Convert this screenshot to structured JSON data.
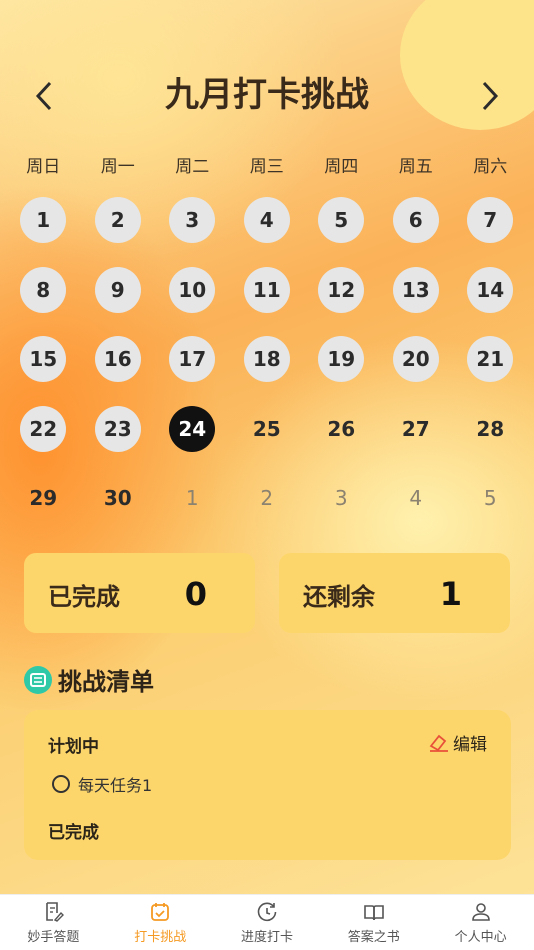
{
  "header": {
    "title": "九月打卡挑战",
    "prev_icon": "chevron-left-icon",
    "next_icon": "chevron-right-icon"
  },
  "calendar": {
    "weekdays": [
      "周日",
      "周一",
      "周二",
      "周三",
      "周四",
      "周五",
      "周六"
    ],
    "weeks": [
      [
        {
          "d": "1",
          "s": "past"
        },
        {
          "d": "2",
          "s": "past"
        },
        {
          "d": "3",
          "s": "past"
        },
        {
          "d": "4",
          "s": "past"
        },
        {
          "d": "5",
          "s": "past"
        },
        {
          "d": "6",
          "s": "past"
        },
        {
          "d": "7",
          "s": "past"
        }
      ],
      [
        {
          "d": "8",
          "s": "past"
        },
        {
          "d": "9",
          "s": "past"
        },
        {
          "d": "10",
          "s": "past"
        },
        {
          "d": "11",
          "s": "past"
        },
        {
          "d": "12",
          "s": "past"
        },
        {
          "d": "13",
          "s": "past"
        },
        {
          "d": "14",
          "s": "past"
        }
      ],
      [
        {
          "d": "15",
          "s": "past"
        },
        {
          "d": "16",
          "s": "past"
        },
        {
          "d": "17",
          "s": "past"
        },
        {
          "d": "18",
          "s": "past"
        },
        {
          "d": "19",
          "s": "past"
        },
        {
          "d": "20",
          "s": "past"
        },
        {
          "d": "21",
          "s": "past"
        }
      ],
      [
        {
          "d": "22",
          "s": "past"
        },
        {
          "d": "23",
          "s": "past"
        },
        {
          "d": "24",
          "s": "today"
        },
        {
          "d": "25",
          "s": "future"
        },
        {
          "d": "26",
          "s": "future"
        },
        {
          "d": "27",
          "s": "future"
        },
        {
          "d": "28",
          "s": "future"
        }
      ],
      [
        {
          "d": "29",
          "s": "future"
        },
        {
          "d": "30",
          "s": "future"
        },
        {
          "d": "1",
          "s": "other"
        },
        {
          "d": "2",
          "s": "other"
        },
        {
          "d": "3",
          "s": "other"
        },
        {
          "d": "4",
          "s": "other"
        },
        {
          "d": "5",
          "s": "other"
        }
      ]
    ]
  },
  "stats": {
    "completed_label": "已完成",
    "completed_value": "0",
    "remaining_label": "还剩余",
    "remaining_value": "1"
  },
  "challenge_list": {
    "title": "挑战清单",
    "icon": "list-icon",
    "planned_heading": "计划中",
    "edit_label": "编辑",
    "tasks": [
      "每天任务1"
    ],
    "completed_heading": "已完成"
  },
  "tabbar": {
    "items": [
      {
        "label": "妙手答题",
        "icon": "edit-doc-icon"
      },
      {
        "label": "打卡挑战",
        "icon": "calendar-check-icon"
      },
      {
        "label": "进度打卡",
        "icon": "progress-icon"
      },
      {
        "label": "答案之书",
        "icon": "book-icon"
      },
      {
        "label": "个人中心",
        "icon": "user-icon"
      }
    ],
    "active_index": 1
  },
  "colors": {
    "accent": "#f59a23",
    "card": "#fdd66b",
    "today": "#111111",
    "past_day": "#e6e6e6",
    "section_icon": "#2fc9a8"
  }
}
